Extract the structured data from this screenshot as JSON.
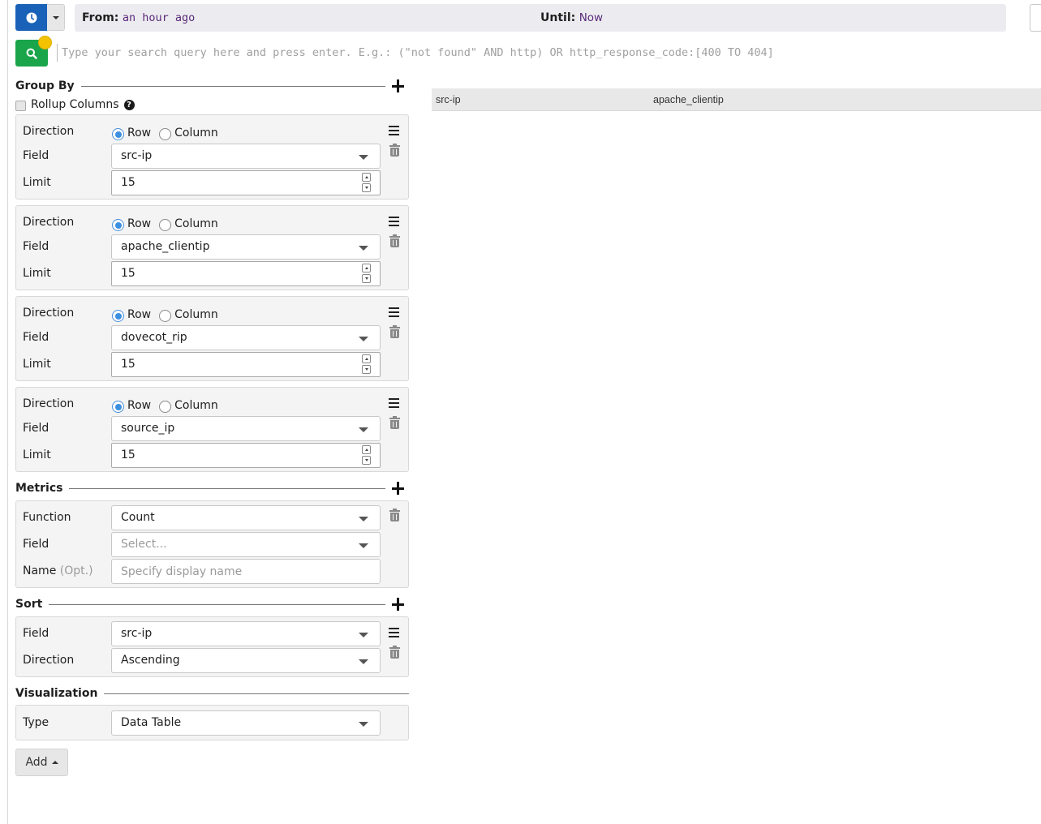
{
  "time_range": {
    "from_label": "From:",
    "from_value": "an hour ago",
    "until_label": "Until:",
    "until_value": "Now"
  },
  "search": {
    "placeholder": "Type your search query here and press enter. E.g.: (\"not found\" AND http) OR http_response_code:[400 TO 404]"
  },
  "group_by": {
    "title": "Group By",
    "rollup_label": "Rollup Columns",
    "direction_label": "Direction",
    "field_label": "Field",
    "limit_label": "Limit",
    "row_option": "Row",
    "column_option": "Column",
    "items": [
      {
        "field": "src-ip",
        "limit": "15",
        "direction": "Row"
      },
      {
        "field": "apache_clientip",
        "limit": "15",
        "direction": "Row"
      },
      {
        "field": "dovecot_rip",
        "limit": "15",
        "direction": "Row"
      },
      {
        "field": "source_ip",
        "limit": "15",
        "direction": "Row"
      }
    ]
  },
  "metrics": {
    "title": "Metrics",
    "function_label": "Function",
    "function_value": "Count",
    "field_label": "Field",
    "field_placeholder": "Select...",
    "name_label": "Name",
    "name_opt": "(Opt.)",
    "name_placeholder": "Specify display name"
  },
  "sort": {
    "title": "Sort",
    "field_label": "Field",
    "field_value": "src-ip",
    "direction_label": "Direction",
    "direction_value": "Ascending"
  },
  "visualization": {
    "title": "Visualization",
    "type_label": "Type",
    "type_value": "Data Table"
  },
  "add_button": "Add",
  "table": {
    "columns": [
      "src-ip",
      "apache_clientip"
    ]
  },
  "colors": {
    "time_button": "#1a62b8",
    "search_button": "#1aa54a",
    "indicator_dot": "#f3c300",
    "radio_checked": "#3d8fe0"
  },
  "icons": {
    "time_button": "clock-icon",
    "search_button": "search-icon",
    "add_section": "plus-icon",
    "reorder": "bars-icon",
    "delete": "trash-icon",
    "help": "question-circle-icon"
  }
}
